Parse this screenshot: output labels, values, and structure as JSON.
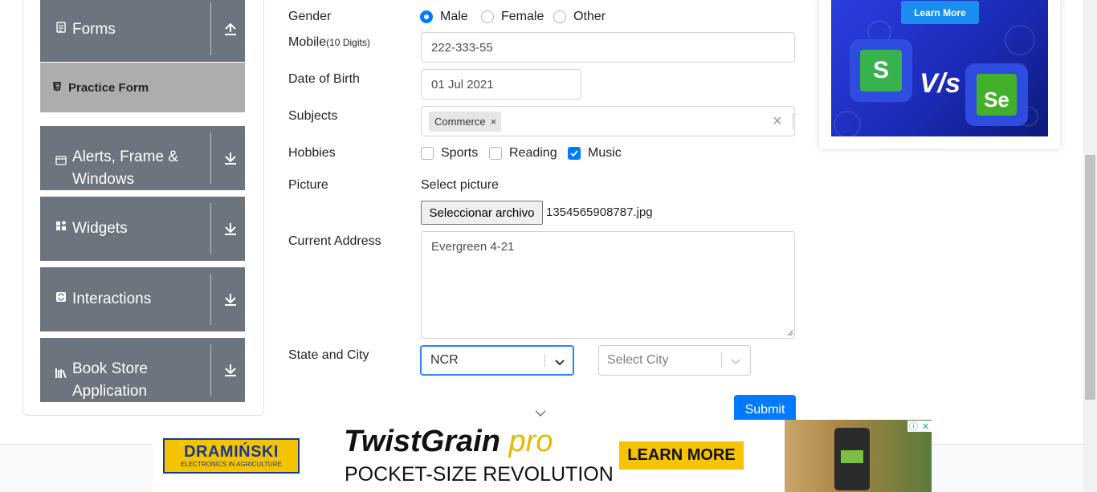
{
  "sidebar": {
    "groups": [
      {
        "label": "Forms",
        "icon": "document-icon",
        "arrow": "upload"
      },
      {
        "label": "Alerts, Frame &",
        "label2": "Windows",
        "icon": "window-icon",
        "arrow": "download"
      },
      {
        "label": "Widgets",
        "icon": "widgets-icon",
        "arrow": "download"
      },
      {
        "label": "Interactions",
        "icon": "interactions-icon",
        "arrow": "download"
      },
      {
        "label": "Book Store",
        "label2": "Application",
        "icon": "books-icon",
        "arrow": "download"
      }
    ],
    "active_item": "Practice Form"
  },
  "form": {
    "gender": {
      "label": "Gender",
      "options": [
        "Male",
        "Female",
        "Other"
      ],
      "selected": "Male"
    },
    "mobile": {
      "label": "Mobile",
      "hint": "(10 Digits)",
      "value": "222-333-55"
    },
    "dob": {
      "label": "Date of Birth",
      "value": "01 Jul 2021"
    },
    "subjects": {
      "label": "Subjects",
      "chips": [
        "Commerce"
      ],
      "clear": "×"
    },
    "hobbies": {
      "label": "Hobbies",
      "options": [
        "Sports",
        "Reading",
        "Music"
      ],
      "checked": [
        "Music"
      ]
    },
    "picture": {
      "label": "Picture",
      "caption": "Select picture",
      "button": "Seleccionar archivo",
      "file": "1354565908787.jpg"
    },
    "address": {
      "label": "Current Address",
      "value": "Evergreen 4-21"
    },
    "state_city": {
      "label": "State and City",
      "state": "NCR",
      "city_placeholder": "Select City"
    },
    "submit": "Submit"
  },
  "ad_right": {
    "button": "Learn More",
    "left_logo": "S",
    "vs": "V/s",
    "right_logo": "Se",
    "accent": "#1a8df0"
  },
  "ad_bottom": {
    "brand": "DRAMIŃSKI",
    "brand_sub": "ELECTRONICS IN AGRICULTURE",
    "headline": "TwistGrain",
    "headline_suffix": "pro",
    "tagline": "POCKET-SIZE REVOLUTION",
    "cta": "LEARN MORE"
  },
  "colors": {
    "primary": "#007bff",
    "sidebar": "#6c757d",
    "active": "#adadad"
  }
}
